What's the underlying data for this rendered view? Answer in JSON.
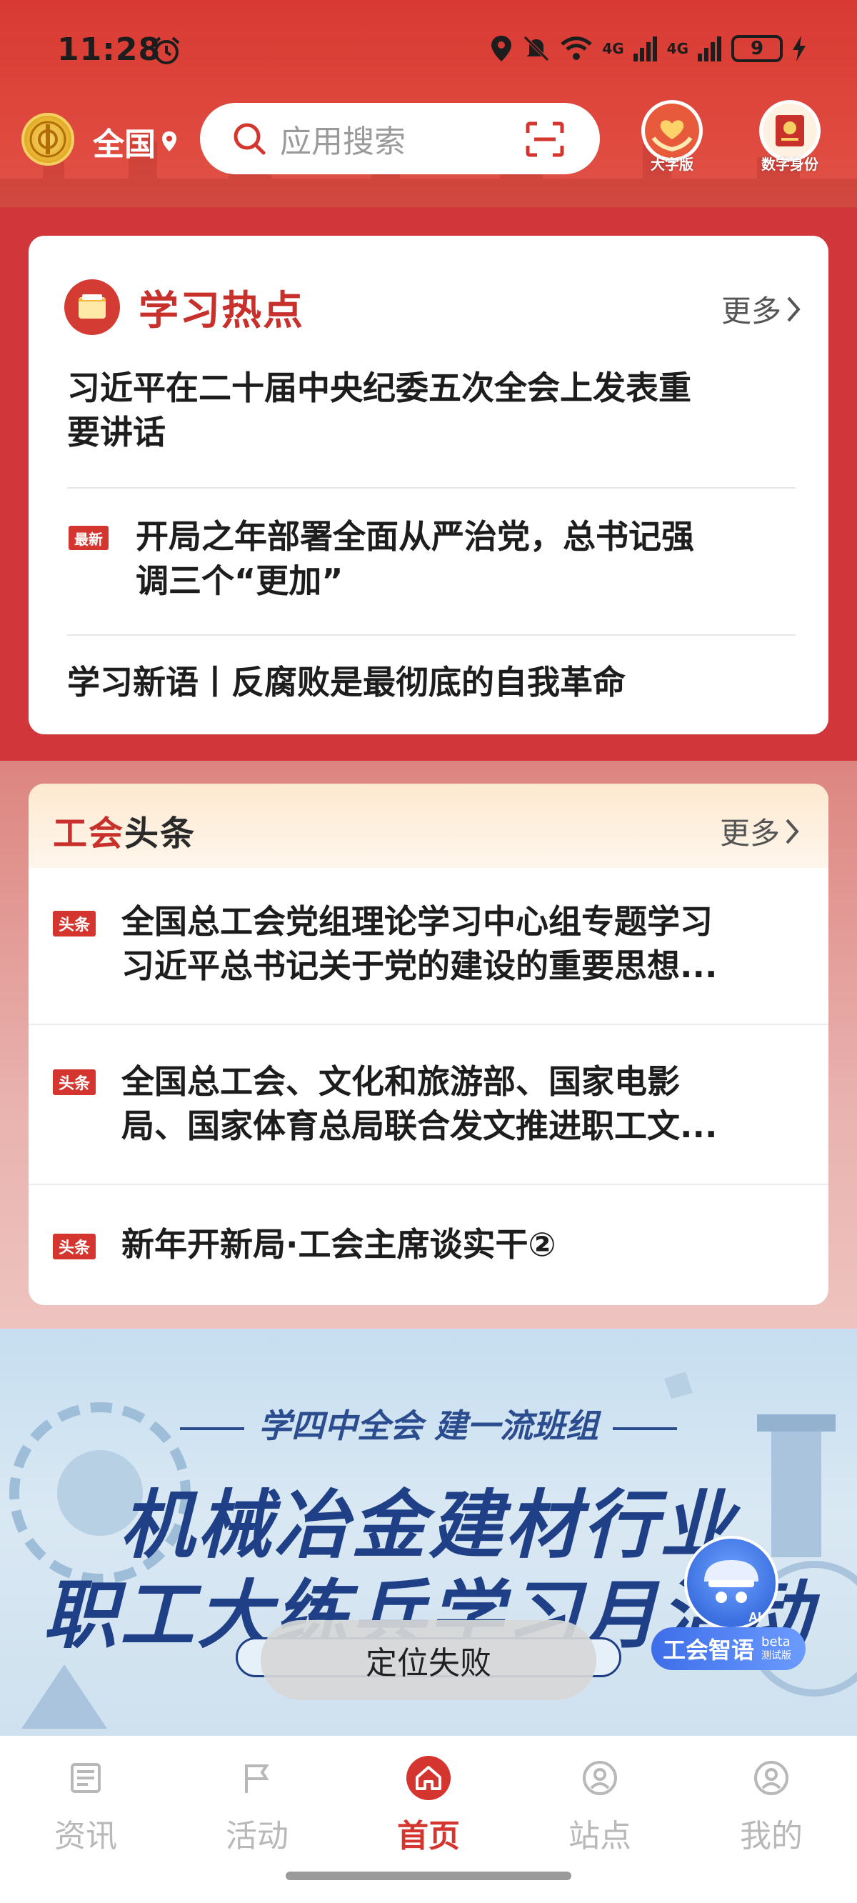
{
  "status_bar": {
    "time": "11:28",
    "battery": "9",
    "network_1": "4G",
    "network_2": "4G"
  },
  "header": {
    "region": "全国",
    "search_placeholder": "应用搜索",
    "quick_links": [
      {
        "label": "大字版",
        "icon": "heart-hands-icon"
      },
      {
        "label": "数字身份",
        "icon": "id-card-icon"
      }
    ]
  },
  "study_hotspot": {
    "title": "学习热点",
    "more_label": "更多",
    "items": [
      {
        "line1": "习近平在二十届中央纪委五次全会上发表重",
        "line2": "要讲话"
      },
      {
        "tag": "最新",
        "line1": "开局之年部署全面从严治党，总书记强",
        "line2": "调三个“更加”"
      },
      {
        "line1": "学习新语丨反腐败是最彻底的自我革命"
      }
    ]
  },
  "headlines": {
    "title_a": "工会",
    "title_b": "头条",
    "more_label": "更多",
    "items": [
      {
        "tag": "头条",
        "line1": "全国总工会党组理论学习中心组专题学习",
        "line2": "习近平总书记关于党的建设的重要思想..."
      },
      {
        "tag": "头条",
        "line1": "全国总工会、文化和旅游部、国家电影",
        "line2": "局、国家体育总局联合发文推进职工文..."
      },
      {
        "tag": "头条",
        "line1": "新年开新局·工会主席谈实干②"
      }
    ]
  },
  "banner": {
    "subtitle": "学四中全会 建一流班组",
    "title_line1": "机械冶金建材行业",
    "title_line2": "职工大练兵学习月活动"
  },
  "toast": "定位失败",
  "ai_assistant": {
    "label": "工会智语",
    "badge": "beta",
    "sub": "测试版",
    "tag": "AI"
  },
  "tabs": [
    {
      "label": "资讯",
      "icon": "news-icon",
      "active": false
    },
    {
      "label": "活动",
      "icon": "flag-icon",
      "active": false
    },
    {
      "label": "首页",
      "icon": "home-icon",
      "active": true
    },
    {
      "label": "站点",
      "icon": "location-icon",
      "active": false
    },
    {
      "label": "我的",
      "icon": "user-icon",
      "active": false
    }
  ],
  "colors": {
    "brand_red": "#d4352e",
    "header_red": "#d83a33",
    "banner_blue": "#1f3f86"
  }
}
